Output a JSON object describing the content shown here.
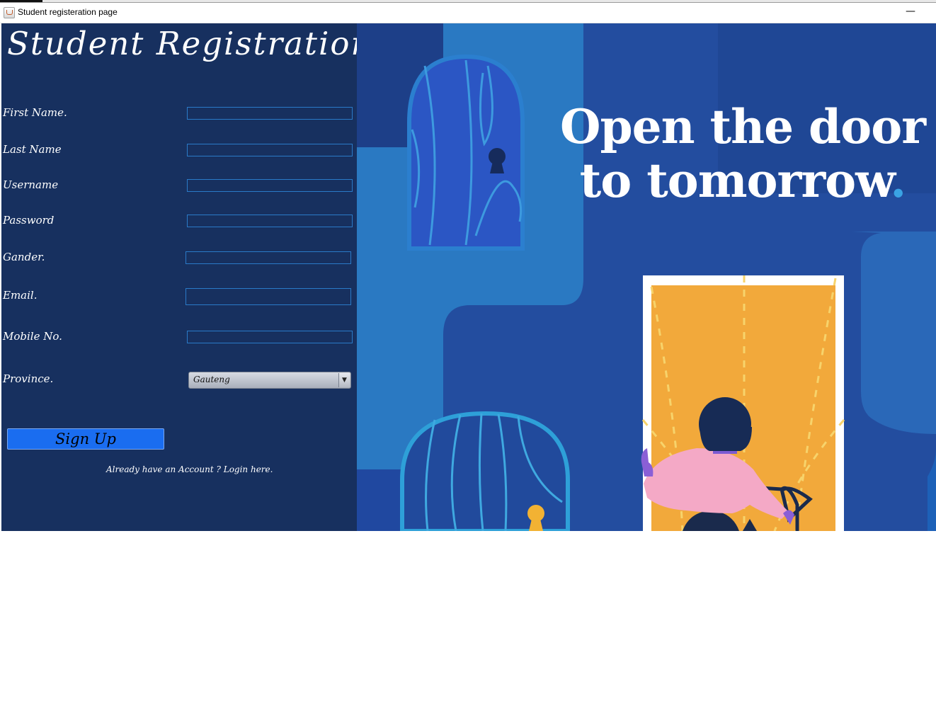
{
  "window": {
    "title": "Student registeration page",
    "minimize": "—"
  },
  "form": {
    "heading": "Student Registration",
    "fields": [
      {
        "label": "First Name.",
        "value": ""
      },
      {
        "label": "Last Name",
        "value": ""
      },
      {
        "label": "Username",
        "value": ""
      },
      {
        "label": "Password",
        "value": ""
      },
      {
        "label": "Gander.",
        "value": ""
      },
      {
        "label": "Email.",
        "value": ""
      },
      {
        "label": "Mobile No.",
        "value": ""
      }
    ],
    "province": {
      "label": "Province.",
      "selected": "Gauteng"
    },
    "signup_label": "Sign Up",
    "login_link": "Already have an Account ? Login here."
  },
  "banner": {
    "line1": "Open the door",
    "line2": "to tomorrow",
    "dot": "."
  },
  "colors": {
    "panel": "#17305f",
    "button": "#1a6df0",
    "field_border": "#2a7ac8",
    "door": "#f2a93b"
  }
}
